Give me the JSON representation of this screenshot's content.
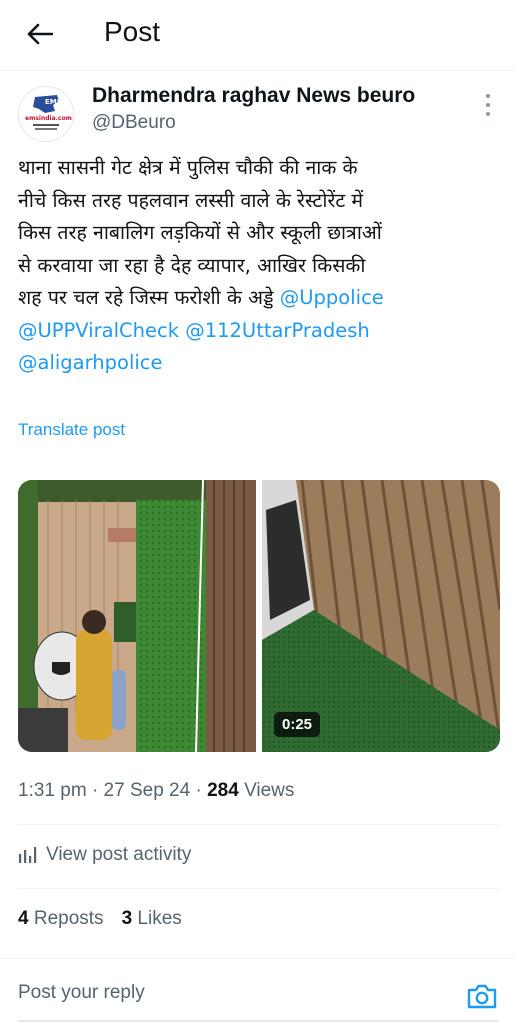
{
  "header": {
    "title": "Post",
    "back_icon": "arrow-left-icon"
  },
  "author": {
    "display_name": "Dharmendra raghav News beuro",
    "handle": "@DBeuro",
    "avatar_logo_text": "EMS",
    "more_icon": "more-vertical-icon"
  },
  "post": {
    "text_lines": [
      "थाना सासनी गेट क्षेत्र में पुलिस चौकी की नाक के",
      "नीचे किस तरह  पहलवान लस्सी वाले के रेस्टोरेंट में",
      "किस तरह नाबालिग लड़कियों से और स्कूली छात्राओं",
      "से करवाया जा रहा है देह व्यापार, आखिर किसकी",
      "शह पर चल रहे जिस्म फरोशी के अड्डे "
    ],
    "mentions": [
      "@Uppolice",
      "@UPPViralCheck",
      "@112UttarPradesh",
      "@aligarhpolice"
    ],
    "translate_label": "Translate post",
    "video_duration": "0:25"
  },
  "meta": {
    "time": "1:31 pm",
    "date": "27 Sep 24",
    "separator": "·",
    "views_count": "284",
    "views_label": "Views"
  },
  "activity": {
    "label": "View post activity",
    "icon": "bar-chart-icon"
  },
  "stats": {
    "reposts_count": "4",
    "reposts_label": "Reposts",
    "likes_count": "3",
    "likes_label": "Likes"
  },
  "reply": {
    "placeholder": "Post your reply",
    "camera_icon": "camera-icon"
  },
  "colors": {
    "accent": "#1d9bf0",
    "text": "#0f1419",
    "secondary": "#536471"
  }
}
